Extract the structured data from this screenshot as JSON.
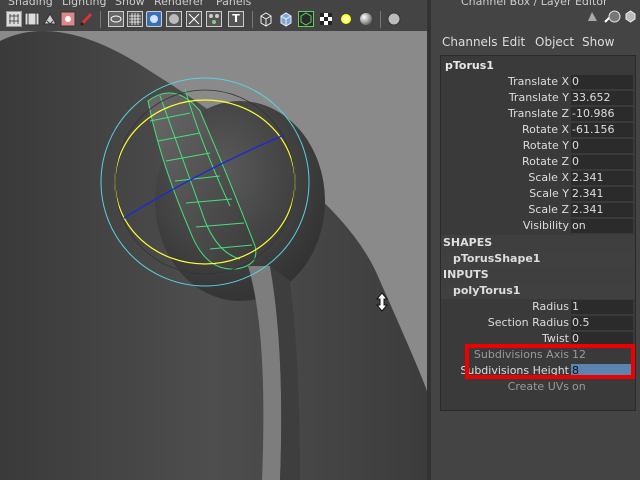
{
  "menubar": [
    "Shading",
    "Lighting",
    "Show",
    "Renderer",
    "Panels"
  ],
  "toolbar_icons": [
    "grid-icon",
    "film-icon",
    "camera-move-icon",
    "paint-icon",
    "brush-icon",
    "wireframe-icon",
    "grid-display-icon",
    "smooth-shade-icon",
    "circle-icon",
    "isolate-icon",
    "texture-icon",
    "text-icon",
    "cube-wire-icon",
    "cube-shaded-icon",
    "cube-select-icon",
    "checker-icon",
    "light-icon",
    "sphere-icon",
    "render-icon"
  ],
  "toolbar_text_icon": "T",
  "viewport": {
    "axis_label": "x"
  },
  "channel_box": {
    "title": "Channel Box / Layer Editor",
    "menu": [
      "Channels",
      "Edit",
      "Object",
      "Show"
    ],
    "object": "pTorus1",
    "transform": [
      {
        "label": "Translate X",
        "value": "0"
      },
      {
        "label": "Translate Y",
        "value": "33.652"
      },
      {
        "label": "Translate Z",
        "value": "-10.986"
      },
      {
        "label": "Rotate X",
        "value": "-61.156"
      },
      {
        "label": "Rotate Y",
        "value": "0"
      },
      {
        "label": "Rotate Z",
        "value": "0"
      },
      {
        "label": "Scale X",
        "value": "2.341"
      },
      {
        "label": "Scale Y",
        "value": "2.341"
      },
      {
        "label": "Scale Z",
        "value": "2.341"
      },
      {
        "label": "Visibility",
        "value": "on"
      }
    ],
    "shapes_header": "SHAPES",
    "shape_name": "pTorusShape1",
    "inputs_header": "INPUTS",
    "input_name": "polyTorus1",
    "inputs": [
      {
        "label": "Radius",
        "value": "1"
      },
      {
        "label": "Section Radius",
        "value": "0.5"
      },
      {
        "label": "Twist",
        "value": "0"
      },
      {
        "label": "Subdivisions Axis",
        "value": "12"
      },
      {
        "label": "Subdivisions Height",
        "value": "8"
      },
      {
        "label": "Create UVs",
        "value": "on"
      }
    ]
  },
  "colors": {
    "highlight": "#ee0000",
    "selection": "#5b84b1"
  }
}
